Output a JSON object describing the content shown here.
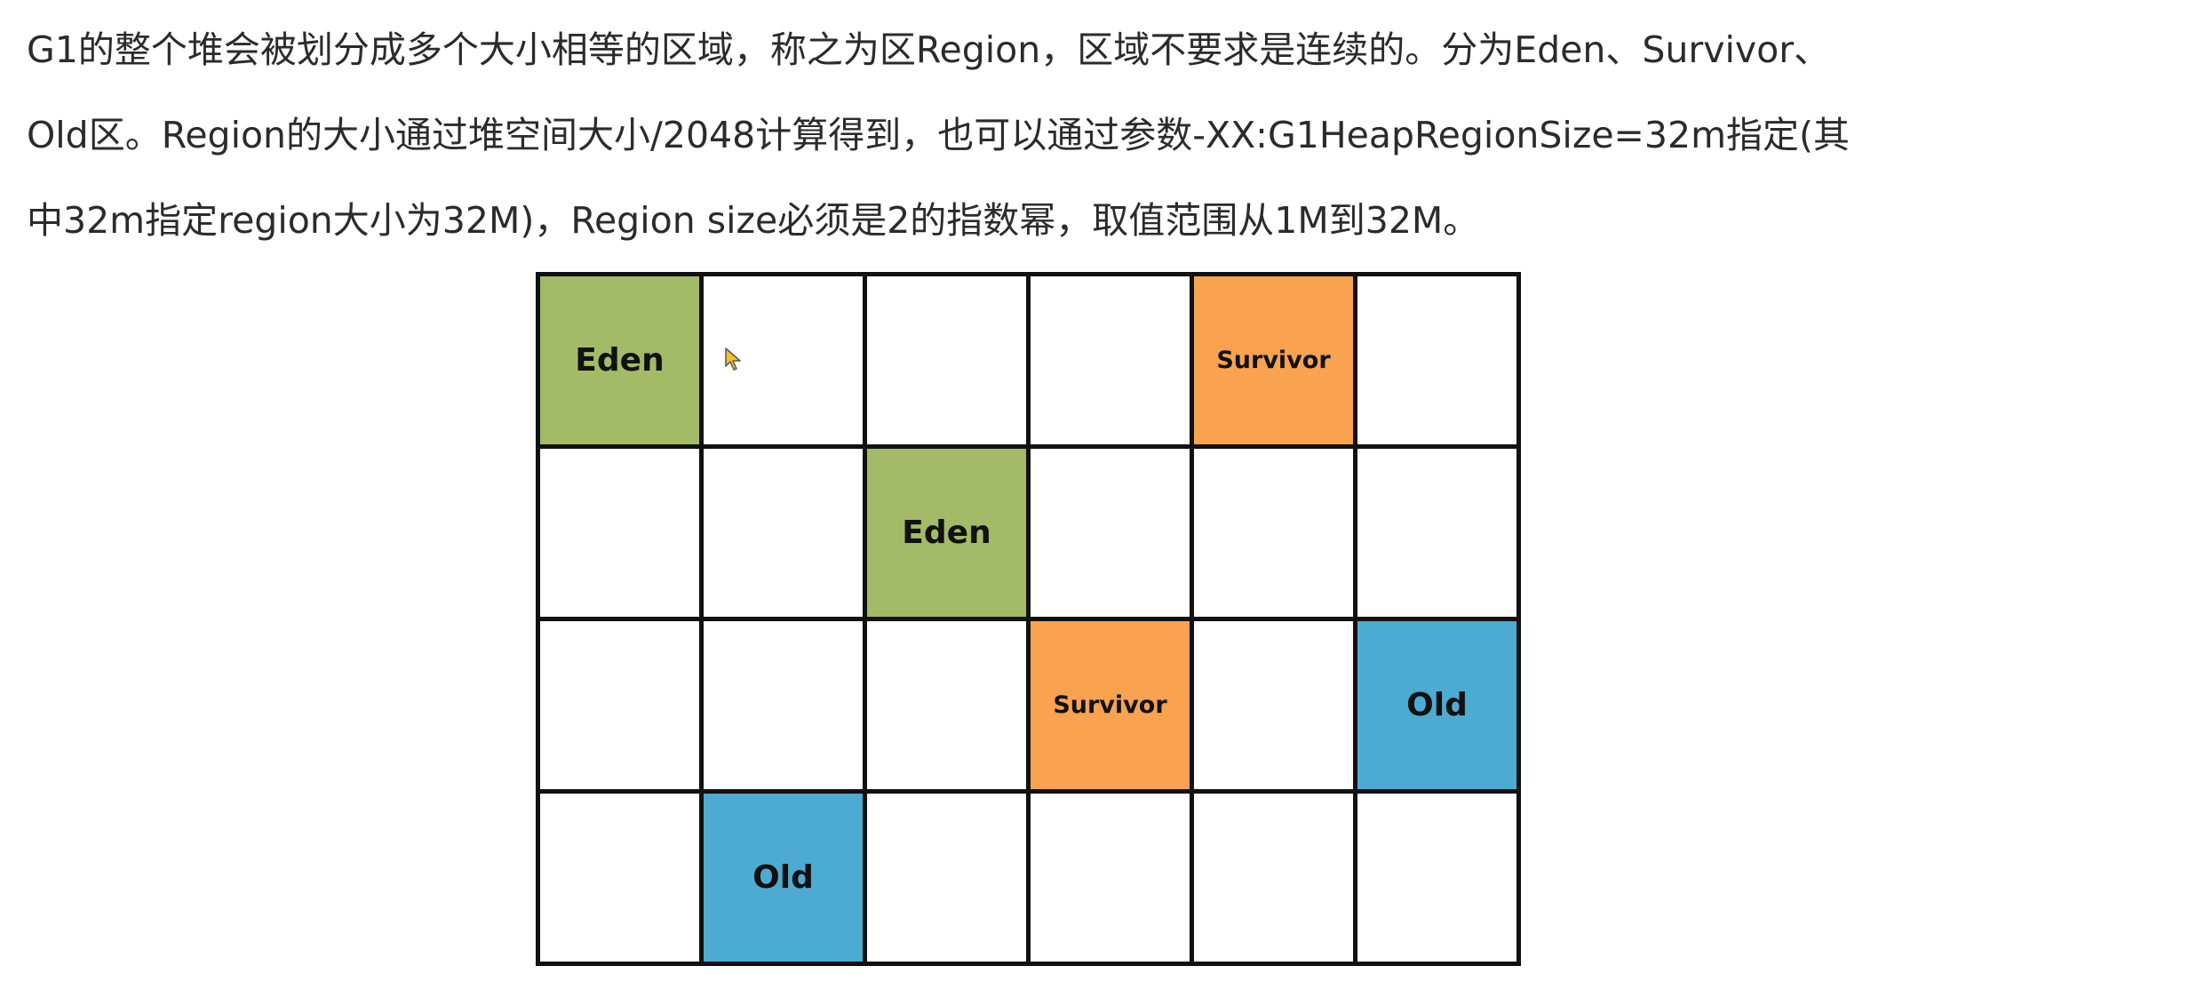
{
  "description": {
    "lines": [
      "G1的整个堆会被划分成多个大小相等的区域，称之为区Region，区域不要求是连续的。分为Eden、Survivor、",
      "Old区。Region的大小通过堆空间大小/2048计算得到，也可以通过参数-XX:G1HeapRegionSize=32m指定(其",
      "中32m指定region大小为32M)，Region size必须是2的指数幂，取值范围从1M到32M。"
    ]
  },
  "colors": {
    "eden": "#a3bb66",
    "survivor": "#f9a24f",
    "old": "#4dabd1",
    "empty": "#ffffff"
  },
  "grid": {
    "rows": 4,
    "cols": 6,
    "cells": [
      [
        "Eden",
        "",
        "",
        "",
        "Survivor",
        ""
      ],
      [
        "",
        "",
        "Eden",
        "",
        "",
        ""
      ],
      [
        "",
        "",
        "",
        "Survivor",
        "",
        "Old"
      ],
      [
        "",
        "Old",
        "",
        "",
        "",
        ""
      ]
    ]
  },
  "cursor": {
    "icon": "mouse-pointer-icon"
  }
}
